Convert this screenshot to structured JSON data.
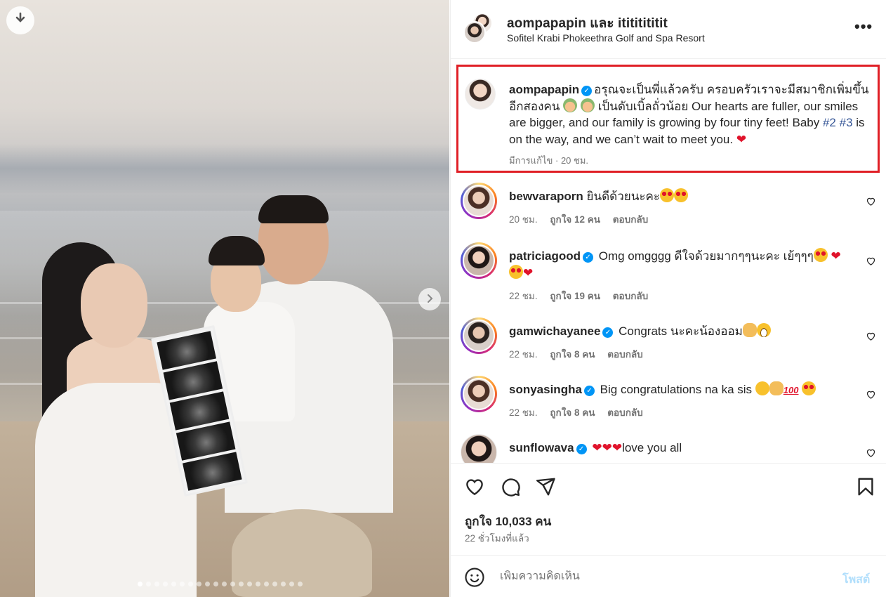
{
  "post": {
    "header": {
      "names": "aompapapin และ itititititit",
      "location": "Sofitel Krabi Phokeethra Golf and Spa Resort",
      "more_icon": "more-horizontal-icon"
    },
    "photo": {
      "download_icon": "download-icon",
      "next_icon": "chevron-right-icon",
      "slide_count": 20,
      "active_slide": 1
    },
    "caption": {
      "username": "aompapapin",
      "text_part1": "อรุณจะเป็นพี่แล้วครับ ครอบครัวเราจะมีสมาชิกเพิ่มขึ้นอีกสองคน",
      "text_part2": "เป็นดับเบิ้ลถั่วน้อย Our hearts are fuller, our smiles are bigger, and our family is growing by four tiny feet! Baby",
      "tag1": "#2",
      "tag2": "#3",
      "text_part3": "is on the way, and we can’t wait to meet you.",
      "heart": "❤",
      "meta": "มีการแก้ไข · 20 ชม."
    },
    "comments": [
      {
        "username": "bewvaraporn",
        "verified": false,
        "text": "ยินดีด้วยนะคะ",
        "time": "20 ชม.",
        "likes": "ถูกใจ 12 คน",
        "reply": "ตอบกลับ"
      },
      {
        "username": "patriciagood",
        "verified": true,
        "text": "Omg omgggg ดีใจด้วยมากๆๆนะคะ เย้ๆๆๆ",
        "time": "22 ชม.",
        "likes": "ถูกใจ 19 คน",
        "reply": "ตอบกลับ"
      },
      {
        "username": "gamwichayanee",
        "verified": true,
        "text": "Congrats นะคะน้องออม",
        "time": "22 ชม.",
        "likes": "ถูกใจ 8 คน",
        "reply": "ตอบกลับ"
      },
      {
        "username": "sonyasingha",
        "verified": true,
        "text": "Big congratulations na ka sis",
        "time": "22 ชม.",
        "likes": "ถูกใจ 8 คน",
        "reply": "ตอบกลับ"
      },
      {
        "username": "sunflowava",
        "verified": true,
        "text": "love you all",
        "hearts": "❤❤❤"
      }
    ],
    "actions": {
      "like_icon": "heart-outline-icon",
      "comment_icon": "comment-icon",
      "share_icon": "send-icon",
      "save_icon": "bookmark-icon"
    },
    "likes": "ถูกใจ 10,033 คน",
    "posted_ago": "22 ชั่วโมงที่แล้ว",
    "add_comment": {
      "placeholder": "เพิ่มความคิดเห็น",
      "post_label": "โพสต์"
    },
    "colors": {
      "verified": "#0095f6",
      "highlight_border": "#e01f26",
      "hashtag": "#385898",
      "post_disabled": "#b2dffc"
    }
  }
}
